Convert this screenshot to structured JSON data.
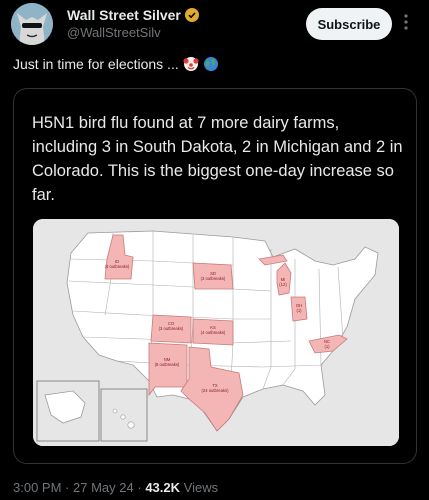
{
  "author": {
    "display_name": "Wall Street Silver",
    "handle": "@WallStreetSilv",
    "avatar": "sunglasses-wolf-avatar",
    "verified": true
  },
  "actions": {
    "subscribe_label": "Subscribe",
    "more_icon": "more-vertical-icon"
  },
  "tweet": {
    "text": "Just in time for elections ...",
    "emojis": [
      "clown-face-emoji",
      "globe-emoji"
    ]
  },
  "media": {
    "headline": "H5N1 bird flu found at 7 more dairy farms, including 3 in South Dakota, 2 in Michigan and 2 in Colorado. This is the biggest one-day increase so far.",
    "map": {
      "highlight_color": "#f4b5b5",
      "states": [
        {
          "abbr": "ID",
          "note": "(4 outbreaks)"
        },
        {
          "abbr": "SD",
          "note": "(3 outbreaks)"
        },
        {
          "abbr": "CO",
          "note": "(3 outbreaks)"
        },
        {
          "abbr": "KS",
          "note": "(4 outbreaks)"
        },
        {
          "abbr": "NM",
          "note": "(8 outbreaks)"
        },
        {
          "abbr": "TX",
          "note": "(24 outbreaks)"
        },
        {
          "abbr": "MI",
          "note": "(12)"
        },
        {
          "abbr": "OH",
          "note": "(1)"
        },
        {
          "abbr": "NC",
          "note": "(1)"
        }
      ]
    }
  },
  "meta": {
    "time": "3:00 PM",
    "date": "27 May 24",
    "views_count": "43.2K",
    "views_label": "Views",
    "separator": "·"
  }
}
